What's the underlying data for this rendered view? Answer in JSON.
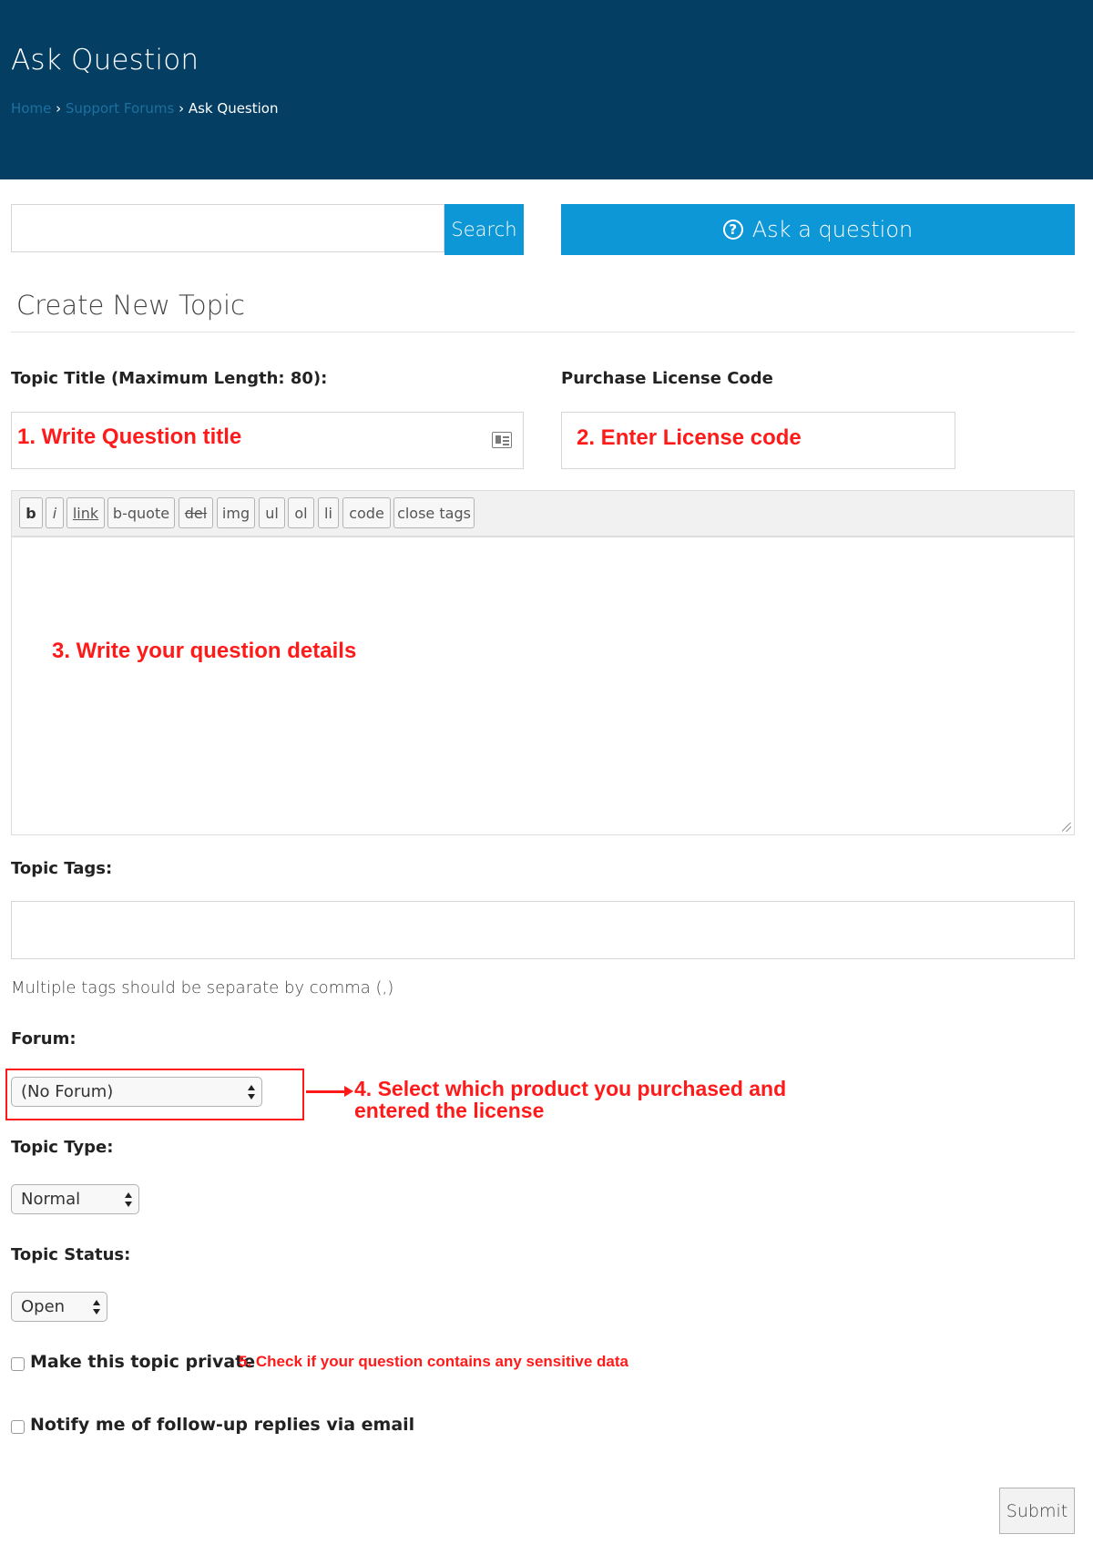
{
  "header": {
    "title": "Ask Question",
    "breadcrumb": {
      "home": "Home",
      "support_forums": "Support Forums",
      "current": "Ask Question",
      "separator": "›"
    }
  },
  "search": {
    "placeholder": "",
    "button_label": "Search"
  },
  "ask_button": {
    "icon": "question-circle-icon",
    "label": "Ask a question"
  },
  "form": {
    "section_title": "Create New Topic",
    "topic_title_label": "Topic Title (Maximum Length: 80):",
    "license_label": "Purchase License Code",
    "toolbar": [
      "b",
      "i",
      "link",
      "b-quote",
      "del",
      "img",
      "ul",
      "ol",
      "li",
      "code",
      "close tags"
    ],
    "tags_label": "Topic Tags:",
    "tags_hint": "Multiple tags should be separate by comma (,)",
    "forum_label": "Forum:",
    "forum_selected": "(No Forum)",
    "topic_type_label": "Topic Type:",
    "topic_type_selected": "Normal",
    "topic_status_label": "Topic Status:",
    "topic_status_selected": "Open",
    "private_label": "Make this topic private",
    "notify_label": "Notify me of follow-up replies via email",
    "submit_label": "Submit"
  },
  "annotations": {
    "step1": "1. Write Question title",
    "step2": "2. Enter License code",
    "step3": "3. Write your question details",
    "step4_line1": "4. Select which product you purchased and",
    "step4_line2": "entered the license",
    "step5": "5. Check if your question contains any sensitive data"
  },
  "colors": {
    "header_bg": "#043f63",
    "accent": "#0e97d6",
    "annotation": "#ff1a1a"
  }
}
